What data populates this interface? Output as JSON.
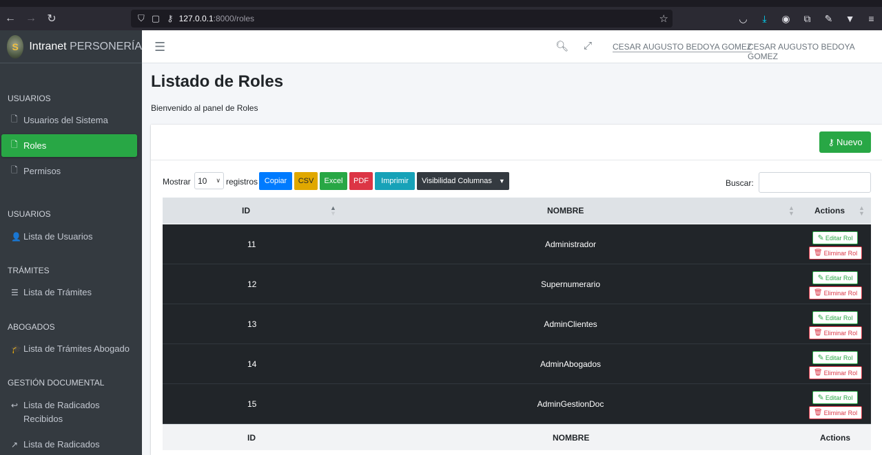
{
  "browser": {
    "url_host": "127.0.0.1",
    "url_path": ":8000/roles"
  },
  "brand": {
    "name_bold": "Intranet",
    "name_light": "PERSONERÍA"
  },
  "sidebar": {
    "sections": [
      {
        "header": "USUARIOS",
        "items": [
          {
            "label": "Usuarios del Sistema",
            "icon": "file-icon"
          },
          {
            "label": "Roles",
            "icon": "file-icon",
            "active": true
          },
          {
            "label": "Permisos",
            "icon": "file-icon"
          }
        ]
      },
      {
        "header": "USUARIOS",
        "items": [
          {
            "label": "Lista de Usuarios",
            "icon": "user-icon"
          }
        ]
      },
      {
        "header": "TRÁMITES",
        "items": [
          {
            "label": "Lista de Trámites",
            "icon": "list-icon"
          }
        ]
      },
      {
        "header": "ABOGADOS",
        "items": [
          {
            "label": "Lista de Trámites Abogado",
            "icon": "graduation-cap-icon"
          }
        ]
      },
      {
        "header": "GESTIÓN DOCUMENTAL",
        "items": [
          {
            "label": "Lista de Radicados Recibidos",
            "icon": "reply-all-icon"
          },
          {
            "label": "Lista de Radicados",
            "icon": "share-square-icon"
          }
        ]
      }
    ]
  },
  "navbar": {
    "user_link": "CESAR AUGUSTO BEDOYA GOMEZ",
    "user_name": "CESAR AUGUSTO BEDOYA GOMEZ"
  },
  "page": {
    "title": "Listado de Roles",
    "welcome": "Bienvenido al panel de Roles",
    "new_button": "Nuevo"
  },
  "datatable": {
    "show_label": "Mostrar",
    "length_value": "10",
    "records_label": "registros",
    "buttons": [
      {
        "label": "Copiar",
        "color": "#007bff"
      },
      {
        "label": "CSV",
        "color": "#e0a800"
      },
      {
        "label": "Excel",
        "color": "#28a745"
      },
      {
        "label": "PDF",
        "color": "#dc3545"
      },
      {
        "label": "Imprimir",
        "color": "#17a2b8"
      },
      {
        "label": "Visibilidad Columnas",
        "color": "#343a40"
      }
    ],
    "search_label": "Buscar:",
    "columns": [
      "ID",
      "NOMBRE",
      "Actions"
    ],
    "rows": [
      {
        "id": "11",
        "name": "Administrador"
      },
      {
        "id": "12",
        "name": "Supernumerario"
      },
      {
        "id": "13",
        "name": "AdminClientes"
      },
      {
        "id": "14",
        "name": "AdminAbogados"
      },
      {
        "id": "15",
        "name": "AdminGestionDoc"
      }
    ],
    "edit_label": "Editar Rol",
    "delete_label": "Eliminar Rol"
  }
}
